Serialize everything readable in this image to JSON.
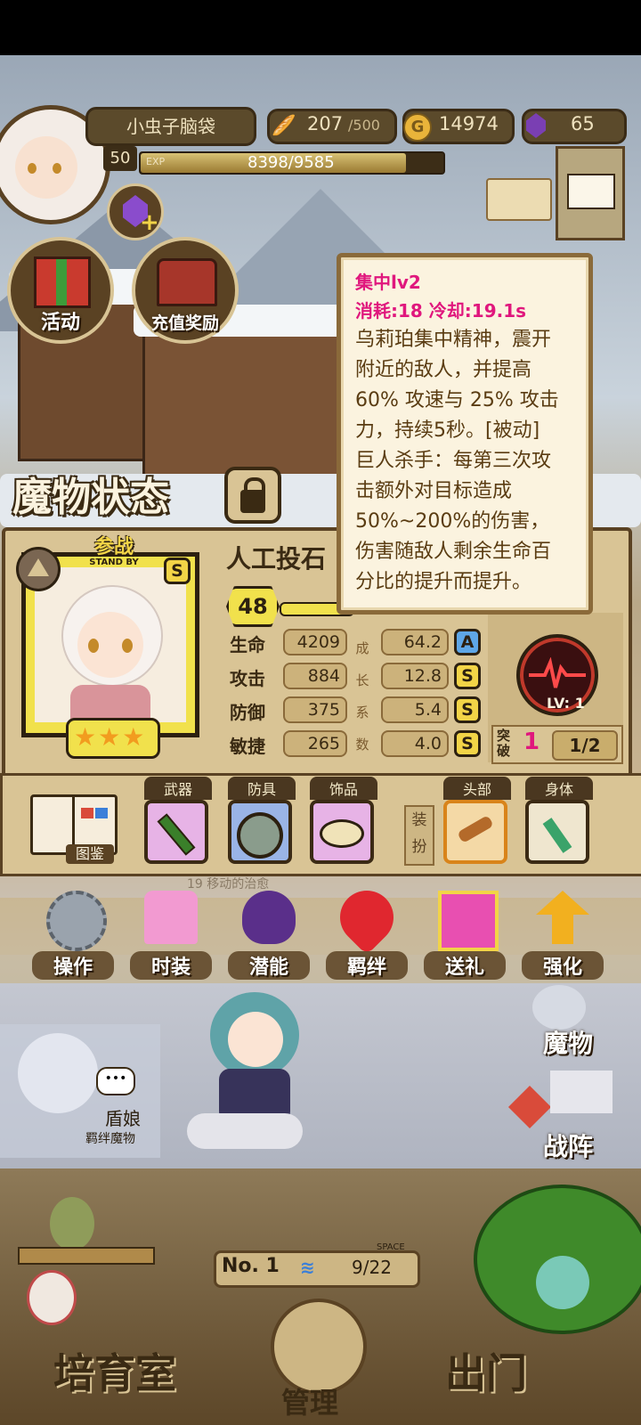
{
  "header": {
    "player_name": "小虫子脑袋",
    "level": "50",
    "exp_label": "EXP",
    "exp_text": "8398/9585",
    "exp_progress": 0.876,
    "stamina": "207",
    "stamina_max": "/500",
    "gold": "14974",
    "gems": "65"
  },
  "events": {
    "activity_label": "活动",
    "recharge_label": "充值奖励"
  },
  "monster_panel": {
    "title": "魔物状态",
    "stand_by_cn": "参战",
    "stand_by_en": "STAND BY",
    "rank_grade": "S",
    "monster_name": "人工投石",
    "level": "48",
    "stats": [
      {
        "name": "生命",
        "value": "4209",
        "growth": "64.2",
        "grade": "A"
      },
      {
        "name": "攻击",
        "value": "884",
        "growth": "12.8",
        "grade": "S"
      },
      {
        "name": "防御",
        "value": "375",
        "growth": "5.4",
        "grade": "S"
      },
      {
        "name": "敏捷",
        "value": "265",
        "growth": "4.0",
        "grade": "S"
      }
    ],
    "growth_chars": [
      "成",
      "长",
      "系",
      "数"
    ],
    "stars": 3,
    "skill_level": "LV: 1",
    "breakthrough_label": "突破",
    "breakthrough_value": "1",
    "breakthrough_progress": "1/2"
  },
  "tooltip": {
    "skill_name": "集中lv2",
    "cost_cooldown": "消耗:18  冷却:19.1s",
    "lines": [
      "乌莉珀集中精神，震开",
      "附近的敌人，并提高",
      "60% 攻速与 25% 攻击",
      "力，持续5秒。[被动]",
      "巨人杀手：每第三次攻",
      "击额外对目标造成",
      "50%~200%的伤害，",
      "伤害随敌人剩余生命百",
      "分比的提升而提升。"
    ]
  },
  "equipment": {
    "codex_label": "图鉴",
    "weapon_label": "武器",
    "armor_label": "防具",
    "accessory_label": "饰品",
    "dress_label": "装扮",
    "head_label": "头部",
    "body_label": "身体"
  },
  "menu": [
    {
      "label": "操作",
      "icon": "gear-icon"
    },
    {
      "label": "时装",
      "icon": "clothing-icon"
    },
    {
      "label": "潜能",
      "icon": "demon-icon"
    },
    {
      "label": "羁绊",
      "icon": "hearts-icon"
    },
    {
      "label": "送礼",
      "icon": "gift-icon"
    },
    {
      "label": "强化",
      "icon": "arrows-up-icon"
    }
  ],
  "side": {
    "monster_label": "魔物",
    "formation_label": "战阵",
    "npc_name": "盾娘",
    "npc_subtitle": "羁绊魔物",
    "speech_dots": "•••"
  },
  "bottom": {
    "rank_label": "No. 1",
    "space_label": "SPACE",
    "space_value": "9/22",
    "nursery_label": "培育室",
    "manage_label": "管理",
    "exit_label": "出门",
    "blurred_text": "移动的治愈",
    "blurred_level": "19"
  },
  "colors": {
    "accent_magenta": "#e0177d",
    "panel_tan": "#d9c495",
    "frame_brown": "#5a4223",
    "grade_gold": "#f2d447",
    "grade_blue": "#5ea6e6"
  }
}
